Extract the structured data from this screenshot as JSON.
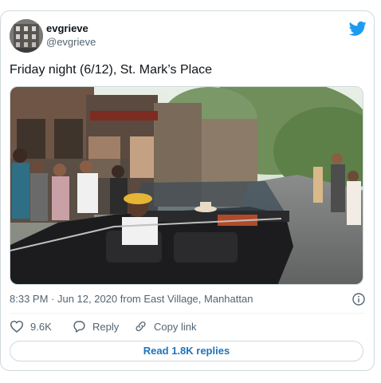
{
  "tweet": {
    "display_name": "evgrieve",
    "handle": "@evgrieve",
    "text": "Friday night (6/12), St. Mark’s Place",
    "timestamp": "8:33 PM · Jun 12, 2020 from East Village, Manhattan"
  },
  "actions": {
    "likes": "9.6K",
    "reply_label": "Reply",
    "copy_link_label": "Copy link"
  },
  "replies_button": "Read 1.8K replies",
  "icons": [
    "twitter-bird-icon",
    "info-icon",
    "heart-icon",
    "reply-icon",
    "link-icon"
  ],
  "colors": {
    "brand": "#1d9bf0",
    "link": "#1d74ba"
  }
}
